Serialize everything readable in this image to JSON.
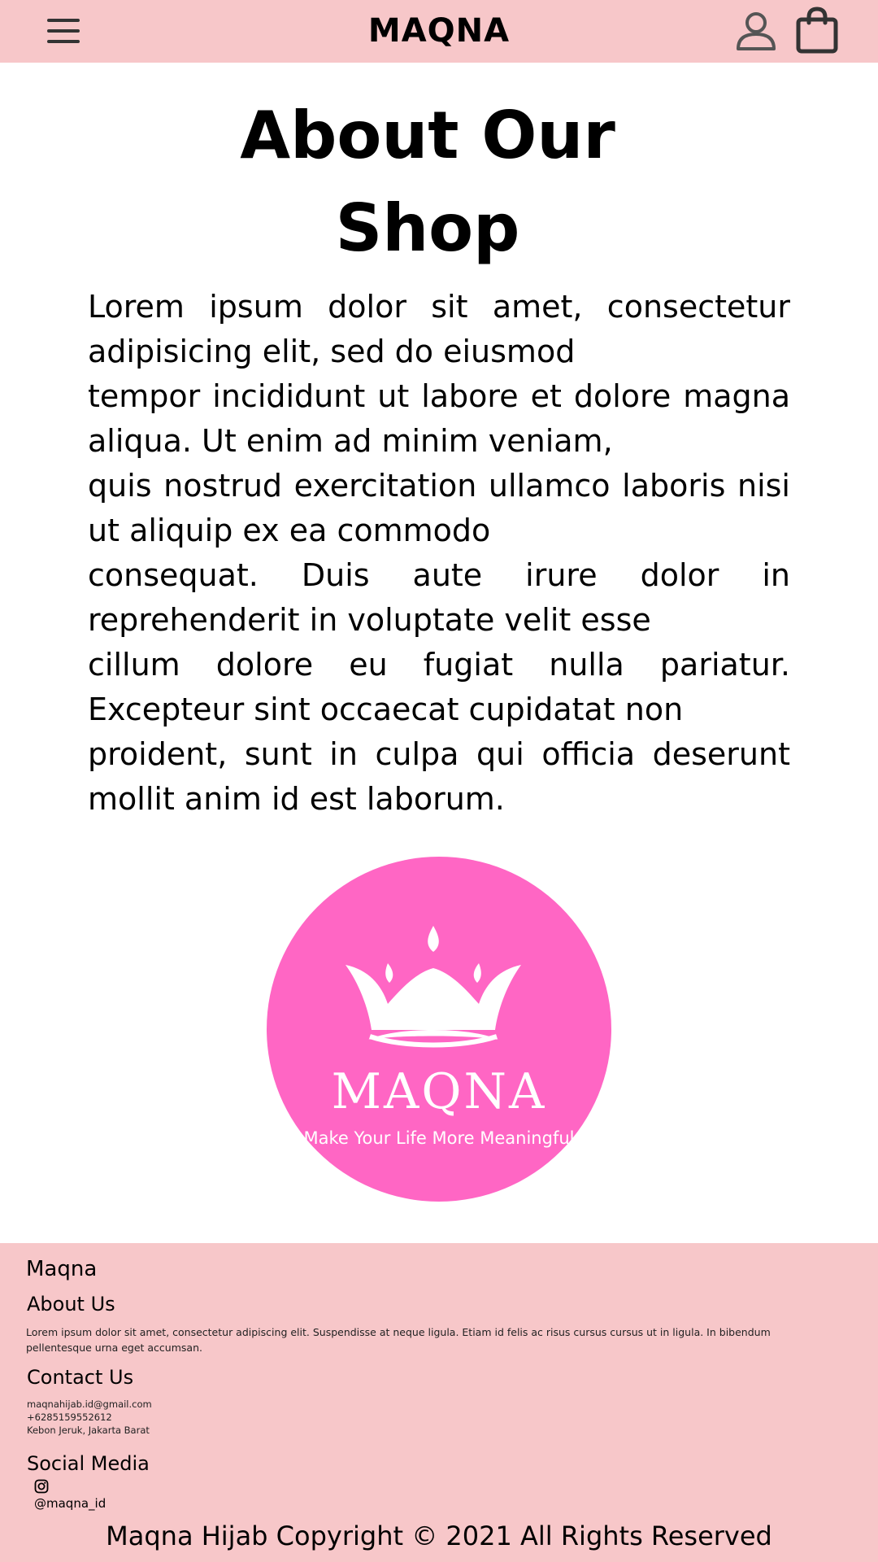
{
  "header": {
    "brand": "MAQNA",
    "menu_icon": "hamburger-menu-icon",
    "user_icon": "user-icon",
    "cart_icon": "shopping-bag-icon"
  },
  "about": {
    "title_line1": "About Our",
    "title_line2": "Shop",
    "body_lines": [
      "Lorem ipsum dolor sit amet, consectetur adipisicing elit, sed do eiusmod",
      "tempor incididunt ut labore et dolore magna aliqua. Ut enim ad minim veniam,",
      "quis nostrud exercitation ullamco laboris nisi ut aliquip ex ea commodo",
      "consequat. Duis aute irure dolor in reprehenderit in voluptate velit esse",
      "cillum dolore eu fugiat nulla pariatur. Excepteur sint occaecat cupidatat non",
      "proident, sunt in culpa qui officia deserunt mollit anim id est laborum."
    ]
  },
  "logo": {
    "wordmark": "MAQNA",
    "tagline": "Make Your Life More Meaningful",
    "circle_color": "#ff66c4"
  },
  "footer": {
    "brand": "Maqna",
    "about_heading": "About Us",
    "about_text": "Lorem ipsum dolor sit amet, consectetur adipiscing elit. Suspendisse at neque ligula. Etiam id felis ac risus cursus cursus ut in ligula. In bibendum pellentesque urna eget accumsan.",
    "contact_heading": "Contact Us",
    "email": "maqnahijab.id@gmail.com",
    "phone": "+6285159552612",
    "address": "Kebon Jeruk, Jakarta Barat",
    "social_heading": "Social Media",
    "instagram_icon": "instagram-icon",
    "instagram_handle": "@maqna_id",
    "copyright": "Maqna Hijab Copyright © 2021 All Rights Reserved"
  },
  "colors": {
    "header_bg": "#f7c7c9",
    "footer_bg": "#f7c7c9",
    "logo_pink": "#ff66c4"
  }
}
